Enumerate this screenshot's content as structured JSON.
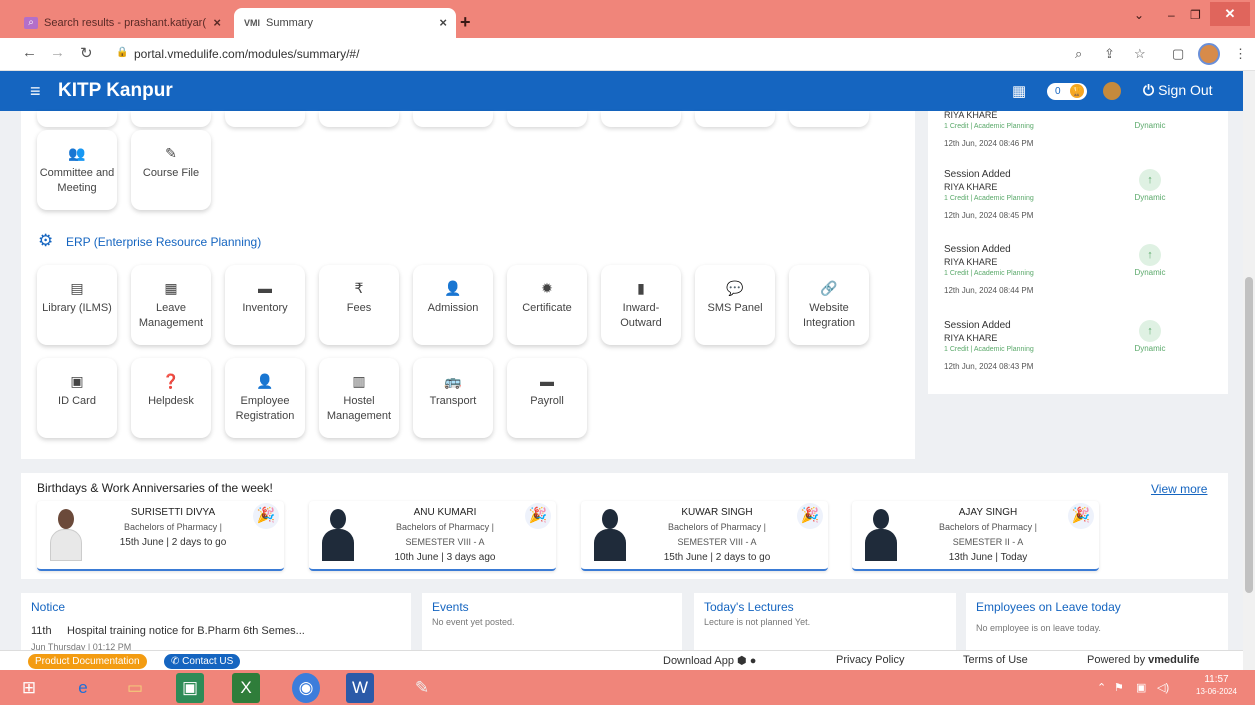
{
  "browser": {
    "tabs": [
      {
        "title": "Search results - prashant.katiyar(",
        "favicon": "search-icon",
        "active": false
      },
      {
        "title": "Summary",
        "favicon_text": "VMl",
        "active": true
      }
    ],
    "url": "portal.vmedulife.com/modules/summary/#/"
  },
  "header": {
    "title": "KITP Kanpur",
    "badge_count": "0",
    "sign_out": "Sign Out"
  },
  "modules_top": [
    {
      "label": "Committee and Meeting",
      "icon": "users-icon"
    },
    {
      "label": "Course File",
      "icon": "file-edit-icon"
    }
  ],
  "erp": {
    "title": "ERP (Enterprise Resource Planning)",
    "row1": [
      {
        "label": "Library (ILMS)",
        "icon": "library-icon"
      },
      {
        "label": "Leave Management",
        "icon": "calendar-icon"
      },
      {
        "label": "Inventory",
        "icon": "inventory-icon"
      },
      {
        "label": "Fees",
        "icon": "rupee-icon"
      },
      {
        "label": "Admission",
        "icon": "user-plus-icon"
      },
      {
        "label": "Certificate",
        "icon": "certificate-icon"
      },
      {
        "label": "Inward-Outward",
        "icon": "document-icon"
      },
      {
        "label": "SMS Panel",
        "icon": "chat-icon"
      },
      {
        "label": "Website Integration",
        "icon": "link-icon"
      }
    ],
    "row2": [
      {
        "label": "ID Card",
        "icon": "id-card-icon"
      },
      {
        "label": "Helpdesk",
        "icon": "help-icon"
      },
      {
        "label": "Employee Registration",
        "icon": "employee-icon"
      },
      {
        "label": "Hostel Management",
        "icon": "building-icon"
      },
      {
        "label": "Transport",
        "icon": "bus-icon"
      },
      {
        "label": "Payroll",
        "icon": "wallet-icon"
      }
    ]
  },
  "activity": {
    "top_partial": {
      "name": "RIYA KHARE",
      "sub": "1 Credit | Academic Planning",
      "date": "12th Jun, 2024 08:46 PM",
      "tag": "Dynamic"
    },
    "items": [
      {
        "title": "Session Added",
        "name": "RIYA KHARE",
        "sub": "1 Credit | Academic Planning",
        "date": "12th Jun, 2024 08:45 PM",
        "tag": "Dynamic"
      },
      {
        "title": "Session Added",
        "name": "RIYA KHARE",
        "sub": "1 Credit | Academic Planning",
        "date": "12th Jun, 2024 08:44 PM",
        "tag": "Dynamic"
      },
      {
        "title": "Session Added",
        "name": "RIYA KHARE",
        "sub": "1 Credit | Academic Planning",
        "date": "12th Jun, 2024 08:43 PM",
        "tag": "Dynamic"
      }
    ]
  },
  "birthdays": {
    "title": "Birthdays & Work Anniversaries of the week!",
    "view_more": "View more",
    "cards": [
      {
        "name": "SURISETTI DIVYA",
        "course": "Bachelors of Pharmacy |",
        "sem": "",
        "date": "15th June | 2 days to go",
        "photo": true
      },
      {
        "name": "ANU KUMARI",
        "course": "Bachelors of Pharmacy |",
        "sem": "SEMESTER VIII - A",
        "date": "10th June | 3 days ago",
        "photo": false
      },
      {
        "name": "KUWAR SINGH",
        "course": "Bachelors of Pharmacy |",
        "sem": "SEMESTER VIII - A",
        "date": "15th June | 2 days to go",
        "photo": false
      },
      {
        "name": "AJAY SINGH",
        "course": "Bachelors of Pharmacy |",
        "sem": "SEMESTER II - A",
        "date": "13th June | Today",
        "photo": false
      }
    ]
  },
  "notice": {
    "title": "Notice",
    "day": "11th",
    "text": "Hospital training notice for B.Pharm 6th Semes...",
    "sub": "Jun     Thursday | 01:12 PM"
  },
  "events": {
    "title": "Events",
    "text": "No event yet posted."
  },
  "lectures": {
    "title": "Today's Lectures",
    "text": "Lecture is not planned Yet."
  },
  "leave": {
    "title": "Employees on Leave today",
    "text": "No employee is on leave today."
  },
  "footer": {
    "product_docs": "Product Documentation",
    "contact": "Contact US",
    "download": "Download App",
    "privacy": "Privacy Policy",
    "terms": "Terms of Use",
    "powered_prefix": "Powered by ",
    "powered_brand": "vmedulife"
  },
  "taskbar": {
    "time": "11:57",
    "date": "13-06-2024"
  },
  "colors": {
    "primary": "#1565c0",
    "chrome": "#f0857a",
    "accent_green": "#5aa96a"
  }
}
